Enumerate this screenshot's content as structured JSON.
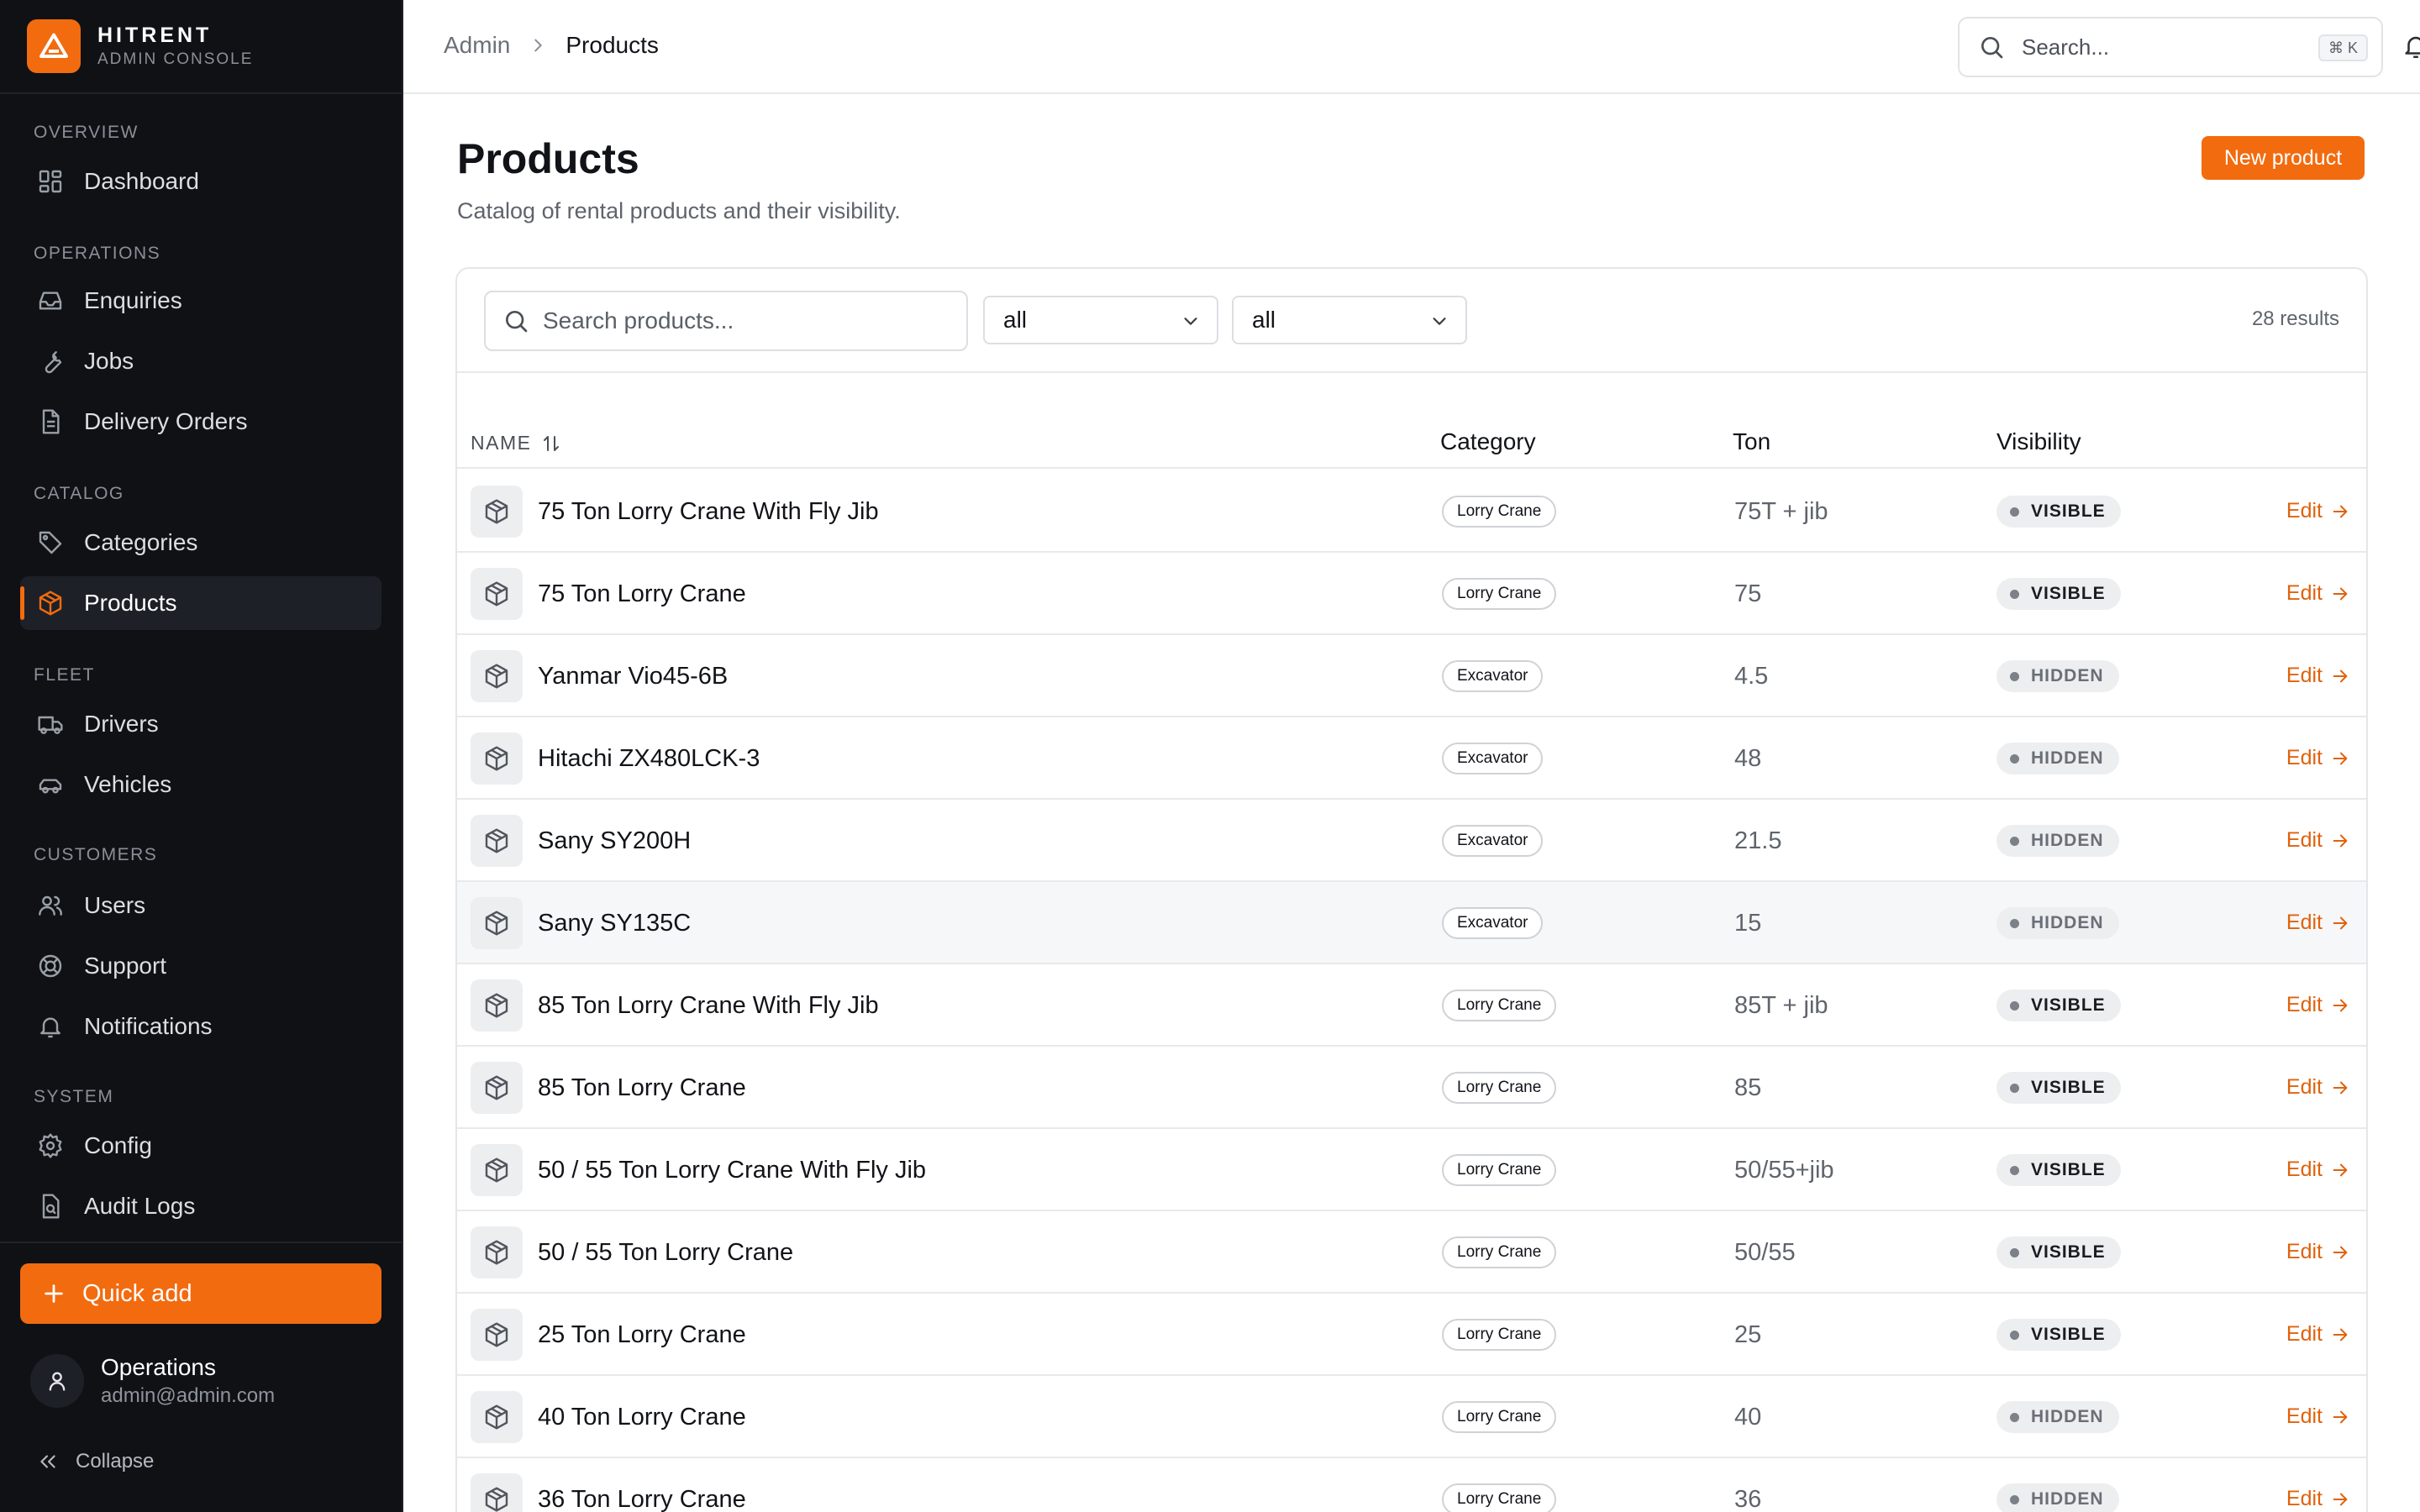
{
  "brand": {
    "name": "HITRENT",
    "subtitle": "ADMIN CONSOLE",
    "accent": "#f26b0f"
  },
  "sidebar": {
    "sections": [
      {
        "label": "OVERVIEW",
        "items": [
          {
            "label": "Dashboard",
            "icon": "dashboard-icon"
          }
        ]
      },
      {
        "label": "OPERATIONS",
        "items": [
          {
            "label": "Enquiries",
            "icon": "inbox-icon"
          },
          {
            "label": "Jobs",
            "icon": "wrench-icon"
          },
          {
            "label": "Delivery Orders",
            "icon": "document-icon"
          }
        ]
      },
      {
        "label": "CATALOG",
        "items": [
          {
            "label": "Categories",
            "icon": "tag-icon"
          },
          {
            "label": "Products",
            "icon": "package-icon",
            "active": true
          }
        ]
      },
      {
        "label": "FLEET",
        "items": [
          {
            "label": "Drivers",
            "icon": "truck-icon"
          },
          {
            "label": "Vehicles",
            "icon": "car-icon"
          }
        ]
      },
      {
        "label": "CUSTOMERS",
        "items": [
          {
            "label": "Users",
            "icon": "users-icon"
          },
          {
            "label": "Support",
            "icon": "lifebuoy-icon"
          },
          {
            "label": "Notifications",
            "icon": "bell-icon"
          }
        ]
      },
      {
        "label": "SYSTEM",
        "items": [
          {
            "label": "Config",
            "icon": "gear-icon"
          },
          {
            "label": "Audit Logs",
            "icon": "audit-icon"
          }
        ]
      }
    ],
    "quick_add": "Quick add",
    "profile": {
      "name": "Operations",
      "email": "admin@admin.com"
    },
    "collapse": "Collapse"
  },
  "topbar": {
    "breadcrumb": {
      "root": "Admin",
      "current": "Products"
    },
    "search_placeholder": "Search...",
    "shortcut": "⌘ K"
  },
  "page": {
    "title": "Products",
    "subtitle": "Catalog of rental products and their visibility.",
    "new_button": "New product"
  },
  "filters": {
    "search_placeholder": "Search products...",
    "category_value": "all",
    "visibility_value": "all",
    "results": "28 results"
  },
  "table": {
    "columns": {
      "name": "NAME",
      "category": "Category",
      "ton": "Ton",
      "visibility": "Visibility"
    },
    "edit_label": "Edit",
    "rows": [
      {
        "name": "75 Ton Lorry Crane With Fly Jib",
        "category": "Lorry Crane",
        "ton": "75T + jib",
        "visibility": "VISIBLE"
      },
      {
        "name": "75 Ton Lorry Crane",
        "category": "Lorry Crane",
        "ton": "75",
        "visibility": "VISIBLE"
      },
      {
        "name": "Yanmar Vio45-6B",
        "category": "Excavator",
        "ton": "4.5",
        "visibility": "HIDDEN"
      },
      {
        "name": "Hitachi ZX480LCK-3",
        "category": "Excavator",
        "ton": "48",
        "visibility": "HIDDEN"
      },
      {
        "name": "Sany SY200H",
        "category": "Excavator",
        "ton": "21.5",
        "visibility": "HIDDEN"
      },
      {
        "name": "Sany SY135C",
        "category": "Excavator",
        "ton": "15",
        "visibility": "HIDDEN"
      },
      {
        "name": "85 Ton Lorry Crane With Fly Jib",
        "category": "Lorry Crane",
        "ton": "85T + jib",
        "visibility": "VISIBLE"
      },
      {
        "name": "85 Ton Lorry Crane",
        "category": "Lorry Crane",
        "ton": "85",
        "visibility": "VISIBLE"
      },
      {
        "name": "50 / 55 Ton Lorry Crane With Fly Jib",
        "category": "Lorry Crane",
        "ton": "50/55+jib",
        "visibility": "VISIBLE"
      },
      {
        "name": "50 / 55 Ton Lorry Crane",
        "category": "Lorry Crane",
        "ton": "50/55",
        "visibility": "VISIBLE"
      },
      {
        "name": "25 Ton Lorry Crane",
        "category": "Lorry Crane",
        "ton": "25",
        "visibility": "VISIBLE"
      },
      {
        "name": "40 Ton Lorry Crane",
        "category": "Lorry Crane",
        "ton": "40",
        "visibility": "HIDDEN"
      },
      {
        "name": "36 Ton Lorry Crane",
        "category": "Lorry Crane",
        "ton": "36",
        "visibility": "HIDDEN"
      }
    ]
  }
}
